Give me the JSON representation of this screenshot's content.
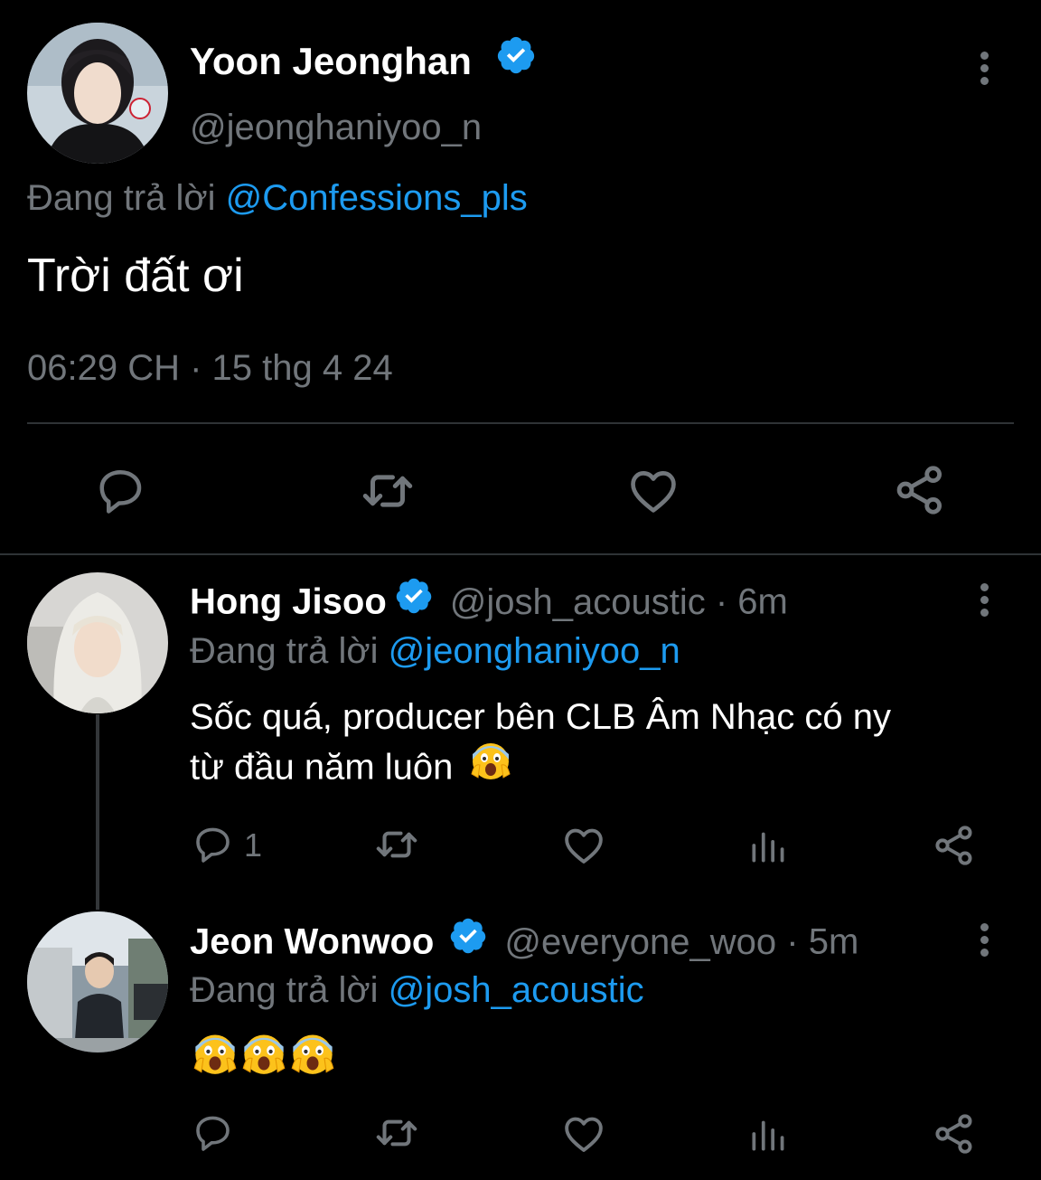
{
  "main_tweet": {
    "author_name": "Yoon Jeonghan",
    "handle": "@jeonghaniyoo_n",
    "replying_prefix": "Đang trả lời",
    "replying_to": "@Confessions_pls",
    "text": "Trời đất ơi",
    "timestamp": "06:29 CH · 15 thg 4 24",
    "actions": [
      "reply-icon",
      "retweet-icon",
      "like-icon",
      "share-icon"
    ]
  },
  "replies": [
    {
      "author_name": "Hong Jisoo",
      "handle": "@josh_acoustic",
      "time": "· 6m",
      "replying_prefix": "Đang trả lời",
      "replying_to": "@jeonghaniyoo_n",
      "text_line1": "Sốc quá, producer bên CLB Âm Nhạc có ny",
      "text_line2": "từ đầu năm luôn",
      "emoji": "screaming-face-emoji",
      "reply_count": "1"
    },
    {
      "author_name": "Jeon Wonwoo",
      "handle": "@everyone_woo",
      "time": "· 5m",
      "replying_prefix": "Đang trả lời",
      "replying_to": "@josh_acoustic",
      "emojis": [
        "screaming-face-emoji",
        "screaming-face-emoji",
        "screaming-face-emoji"
      ],
      "reply_count": ""
    }
  ],
  "colors": {
    "background": "#000000",
    "text": "#e7e9ea",
    "muted": "#71767b",
    "link": "#1d9bf0",
    "verified": "#1d9bf0",
    "divider": "#2f3336"
  }
}
